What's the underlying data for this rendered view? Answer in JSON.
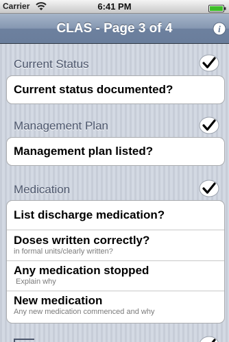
{
  "status_bar": {
    "carrier": "Carrier",
    "time": "6:41 PM",
    "wifi_icon": "wifi-icon",
    "battery_icon": "battery-icon"
  },
  "nav": {
    "title": "CLAS - Page 3 of 4",
    "info_icon": "info-icon"
  },
  "colors": {
    "nav_bar": "#7a8ca8",
    "background": "#cdd3dd",
    "section_header_text": "#4c566c"
  },
  "sections": [
    {
      "header": "Current Status",
      "checked": true,
      "items": [
        {
          "title": "Current status documented?"
        }
      ]
    },
    {
      "header": "Management Plan",
      "checked": true,
      "items": [
        {
          "title": "Management plan listed?"
        }
      ]
    },
    {
      "header": "Medication",
      "checked": true,
      "items": [
        {
          "title": "List discharge medication?"
        },
        {
          "title": "Doses written correctly?",
          "subtitle": "in formal units/clearly written?"
        },
        {
          "title": "Any medication stopped",
          "subtitle": "Explain why"
        },
        {
          "title": "New medication",
          "subtitle": "Any new medication commenced and why"
        }
      ]
    }
  ]
}
